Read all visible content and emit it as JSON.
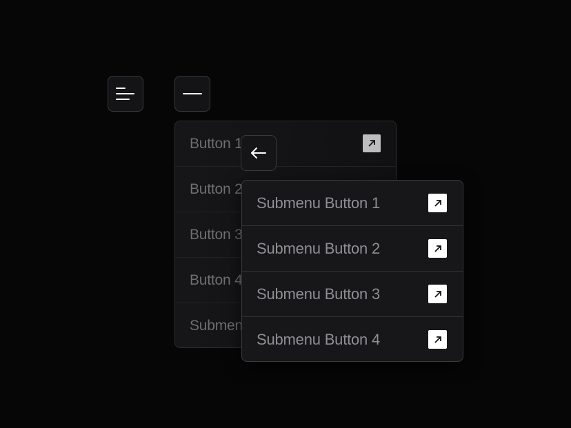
{
  "toolbar": {
    "menu_icon": "menu-lines-icon",
    "close_icon": "minus-icon",
    "back_icon": "arrow-left-icon"
  },
  "menu": {
    "items": [
      {
        "label": "Button 1",
        "icon": "arrow-up-right-icon"
      },
      {
        "label": "Button 2"
      },
      {
        "label": "Button 3"
      },
      {
        "label": "Button 4"
      },
      {
        "label": "Submenu"
      }
    ]
  },
  "submenu": {
    "items": [
      {
        "label": "Submenu Button 1",
        "icon": "arrow-up-right-icon"
      },
      {
        "label": "Submenu Button 2",
        "icon": "arrow-up-right-icon"
      },
      {
        "label": "Submenu Button 3",
        "icon": "arrow-up-right-icon"
      },
      {
        "label": "Submenu Button 4",
        "icon": "arrow-up-right-icon"
      }
    ]
  },
  "colors": {
    "background": "#060606",
    "panel": "#141416",
    "border": "#3a3a3e",
    "text_muted": "#6e6e72",
    "text_sub": "#8f8f93",
    "icon_box": "#ffffff"
  }
}
